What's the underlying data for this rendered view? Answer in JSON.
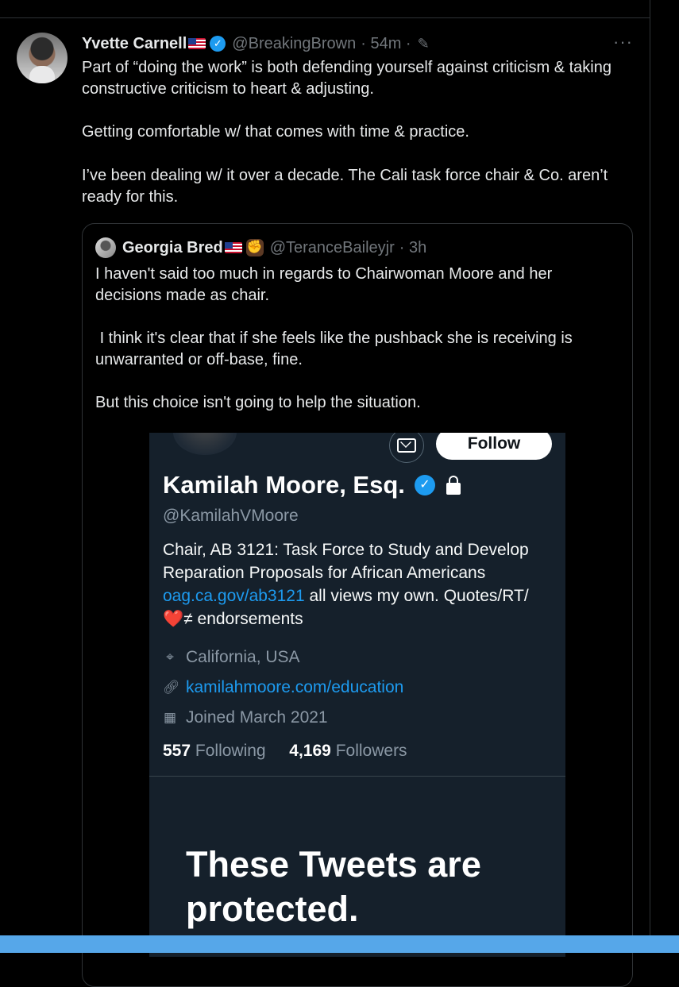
{
  "tweet": {
    "author_name": "Yvette Carnell",
    "handle": "@BreakingBrown",
    "time": "· 54m ·",
    "more_label": "···",
    "paragraphs": [
      "Part of “doing the work” is both defending yourself against criticism & taking constructive criticism to heart & adjusting.",
      "Getting comfortable w/ that comes with time & practice.",
      "I’ve been dealing w/ it over a decade. The Cali task force chair & Co. aren’t ready for this."
    ]
  },
  "quote": {
    "author_name": "Georgia Bred",
    "handle": "@TeranceBaileyjr",
    "time": "· 3h",
    "paragraphs": [
      "I haven't said too much in regards to Chairwoman Moore and her decisions made as chair.",
      " I think it's clear that if she feels like the pushback she is receiving is unwarranted or off-base, fine.",
      "But this choice isn't going to help the situation."
    ]
  },
  "embed": {
    "follow_label": "Follow",
    "name": "Kamilah Moore, Esq.",
    "handle": "@KamilahVMoore",
    "bio_line1": "Chair, AB 3121: Task Force to Study and Develop Reparation Proposals for African Americans",
    "bio_link": "oag.ca.gov/ab3121",
    "bio_line2": " all views my own. Quotes/RT/",
    "bio_heart": "❤️",
    "bio_line3": "≠ endorsements",
    "location": "California, USA",
    "website": "kamilahmoore.com/education",
    "joined": "Joined March 2021",
    "following_count": "557",
    "following_label": "Following",
    "followers_count": "4,169",
    "followers_label": "Followers",
    "protected_text": "These Tweets are protected."
  }
}
